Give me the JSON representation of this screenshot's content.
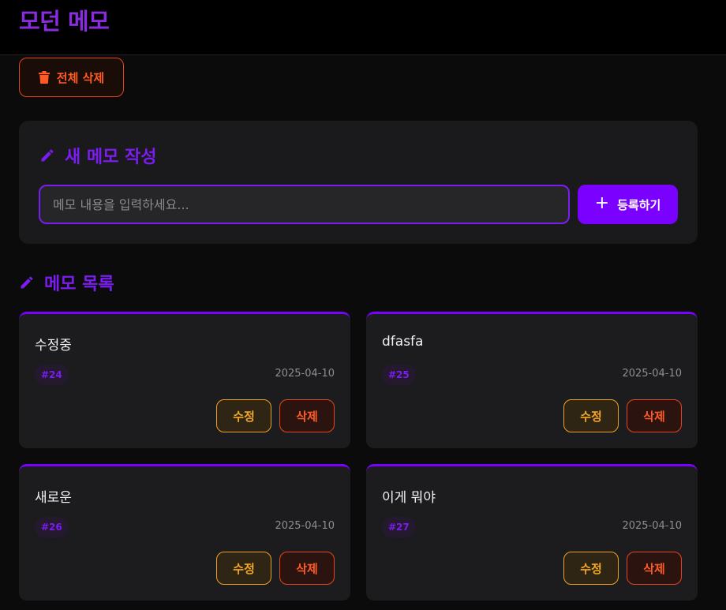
{
  "app": {
    "title": "모던 메모"
  },
  "toolbar": {
    "clear_all_label": "전체 삭제"
  },
  "compose": {
    "title": "새 메모 작성",
    "input_placeholder": "메모 내용을 입력하세요...",
    "input_value": "",
    "submit_label": "등록하기",
    "submit_icon": "+"
  },
  "list": {
    "title": "메모 목록"
  },
  "memos": [
    {
      "text": "수정중",
      "id": "#24",
      "date": "2025-04-10",
      "edit_label": "수정",
      "delete_label": "삭제"
    },
    {
      "text": "dfasfa",
      "id": "#25",
      "date": "2025-04-10",
      "edit_label": "수정",
      "delete_label": "삭제"
    },
    {
      "text": "새로운",
      "id": "#26",
      "date": "2025-04-10",
      "edit_label": "수정",
      "delete_label": "삭제"
    },
    {
      "text": "이게 뭐야",
      "id": "#27",
      "date": "2025-04-10",
      "edit_label": "수정",
      "delete_label": "삭제"
    }
  ],
  "icons": {
    "clear_all": "trash-icon",
    "compose": "pencil-icon",
    "list": "pencil-icon",
    "submit": "plus-icon"
  },
  "colors": {
    "accent": "#7a00ff",
    "danger": "#ff5a26",
    "warning": "#f5a623",
    "background": "#0b0b0c",
    "card": "#1c1c1e"
  }
}
